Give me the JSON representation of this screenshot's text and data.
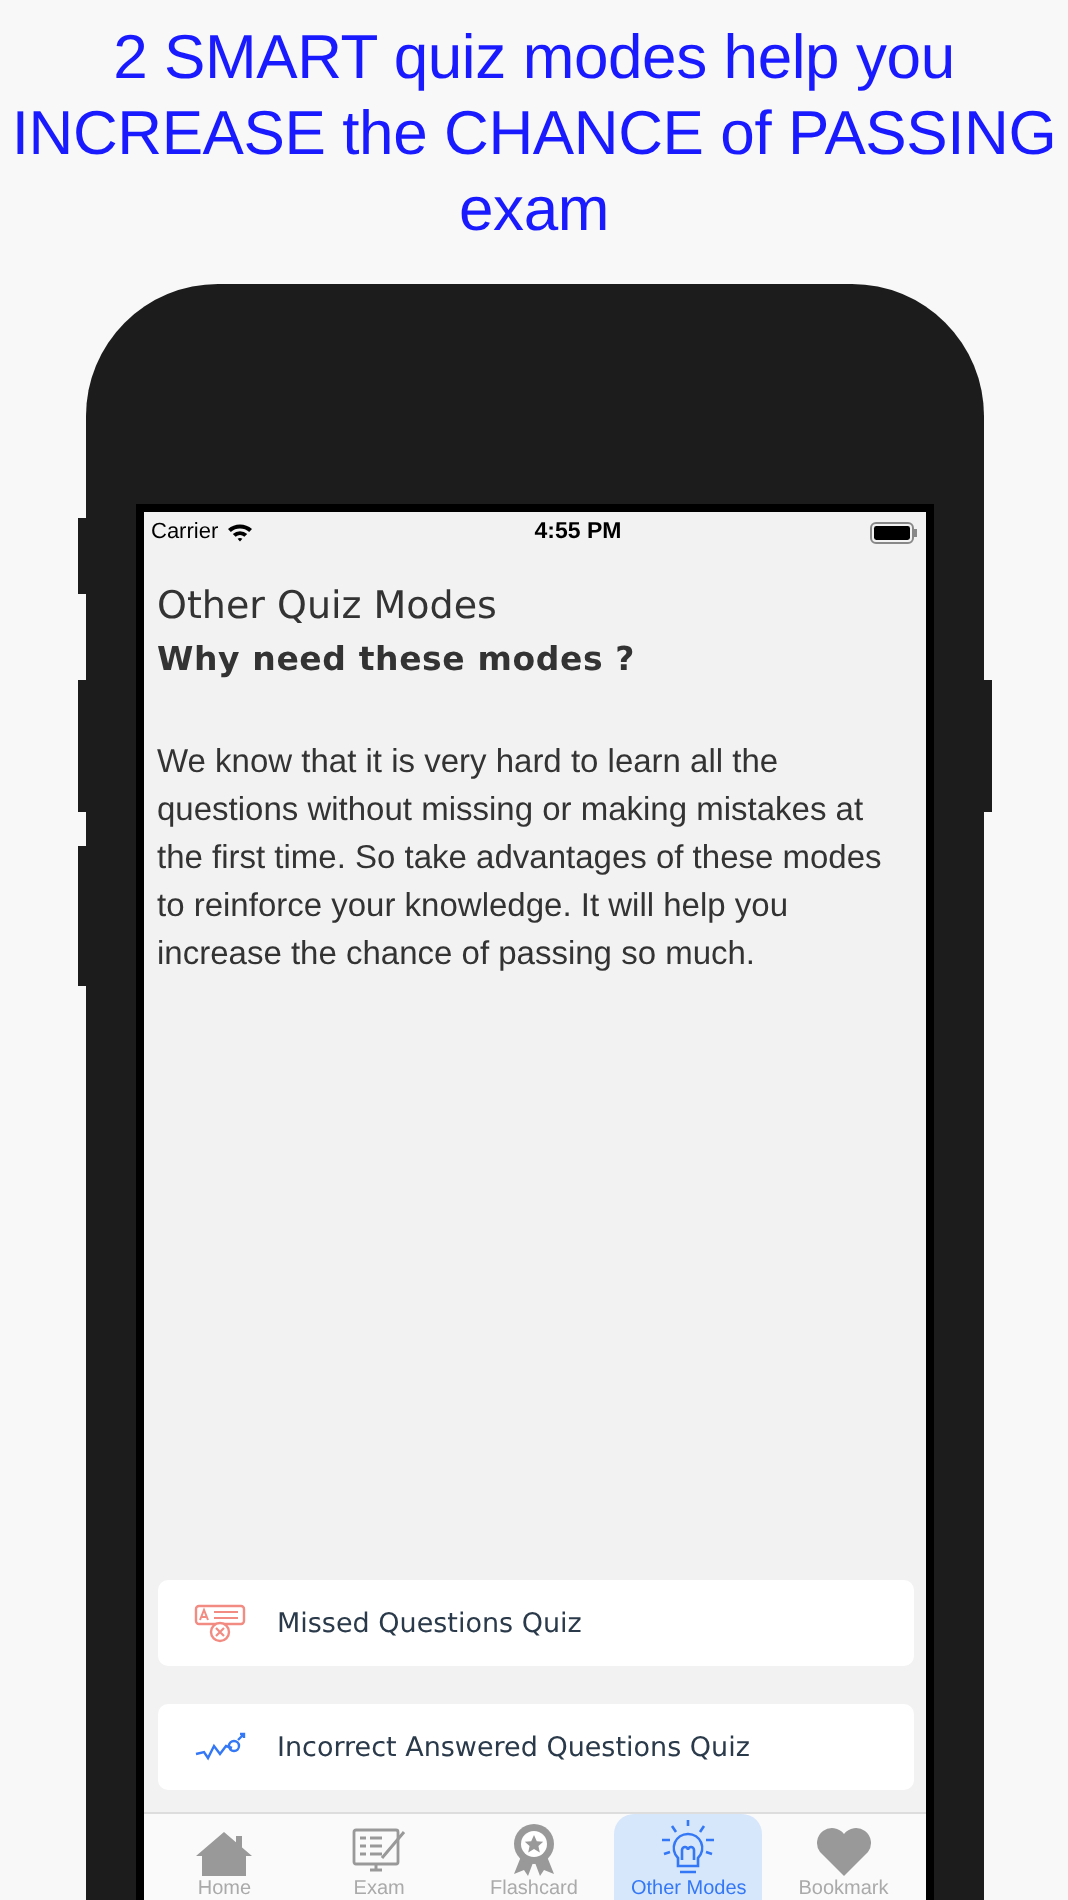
{
  "headline": "2 SMART quiz modes help you INCREASE the CHANCE of PASSING exam",
  "status_bar": {
    "carrier": "Carrier",
    "time": "4:55 PM"
  },
  "title": "Other Quiz Modes",
  "subtitle": "Why need these modes ?",
  "description": "We know that it is very hard to learn all the questions without missing or making mistakes at the first time. So take advantages of these modes to reinforce your knowledge. It will help you increase the chance of passing so much.",
  "modes": [
    {
      "kind": "missed",
      "label": "Missed Questions Quiz"
    },
    {
      "kind": "incorrect",
      "label": "Incorrect Answered Questions Quiz"
    }
  ],
  "tab_bar": [
    {
      "kind": "home",
      "label": "Home",
      "selected": false
    },
    {
      "kind": "exam",
      "label": "Exam",
      "selected": false
    },
    {
      "kind": "flashcard",
      "label": "Flashcard",
      "selected": false
    },
    {
      "kind": "modes",
      "label": "Other Modes",
      "selected": true
    },
    {
      "kind": "bookmark",
      "label": "Bookmark",
      "selected": false
    }
  ]
}
